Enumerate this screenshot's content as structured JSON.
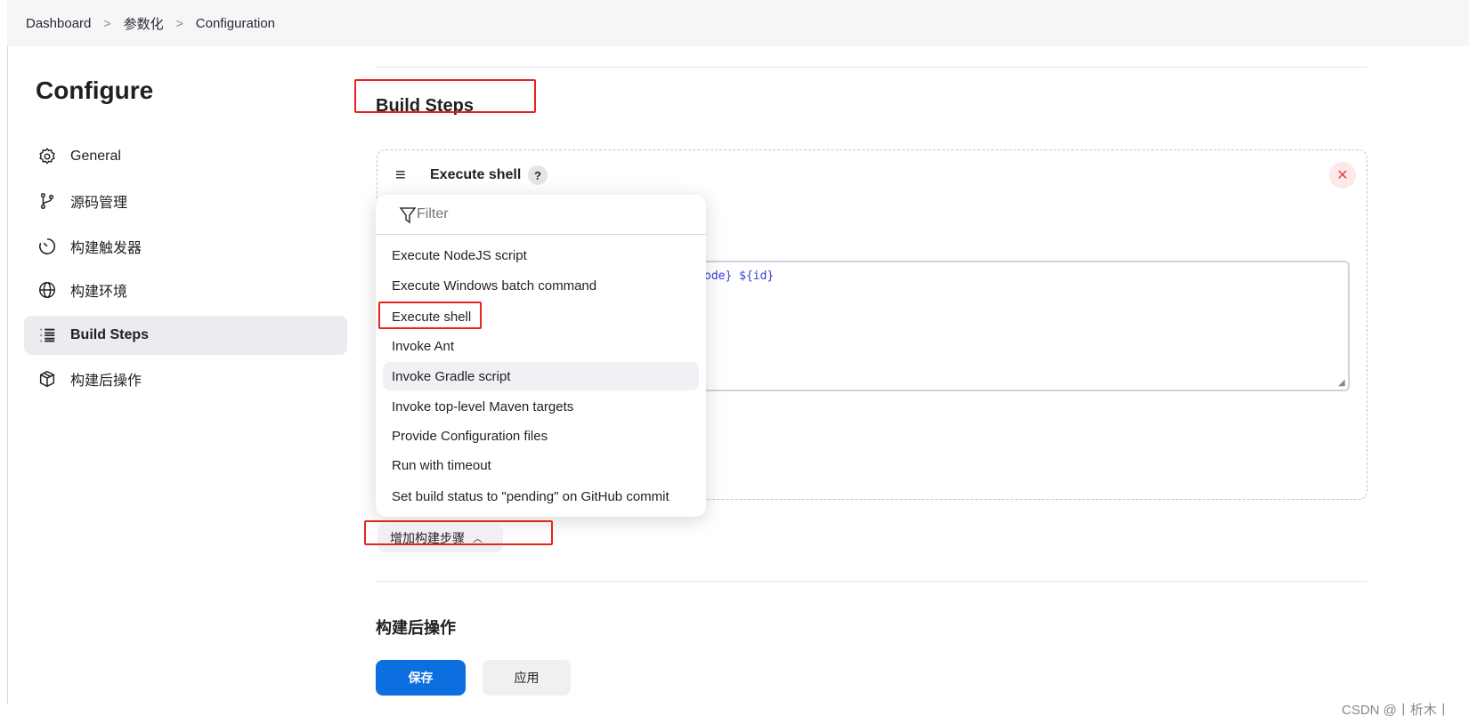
{
  "breadcrumb": [
    "Dashboard",
    "参数化",
    "Configuration"
  ],
  "page_title": "Configure",
  "sidebar": {
    "items": [
      {
        "label": "General",
        "icon": "gear-icon"
      },
      {
        "label": "源码管理",
        "icon": "branch-icon"
      },
      {
        "label": "构建触发器",
        "icon": "timer-icon"
      },
      {
        "label": "构建环境",
        "icon": "globe-icon"
      },
      {
        "label": "Build Steps",
        "icon": "list-icon",
        "active": true
      },
      {
        "label": "构建后操作",
        "icon": "package-icon"
      }
    ]
  },
  "build_steps": {
    "title": "Build Steps",
    "step": {
      "title": "Execute shell",
      "help": "?",
      "command_visible": "ode} ${id}"
    },
    "add_button": "增加构建步骤"
  },
  "dropdown": {
    "filter_placeholder": "Filter",
    "options": [
      "Execute NodeJS script",
      "Execute Windows batch command",
      "Execute shell",
      "Invoke Ant",
      "Invoke Gradle script",
      "Invoke top-level Maven targets",
      "Provide Configuration files",
      "Run with timeout",
      "Set build status to \"pending\" on GitHub commit"
    ],
    "hovered": "Invoke Gradle script",
    "highlighted": "Execute shell"
  },
  "post_build": {
    "title": "构建后操作"
  },
  "footer": {
    "save": "保存",
    "apply": "应用"
  },
  "watermark": "CSDN @丨析木丨",
  "colors": {
    "primary": "#0b6fe0",
    "annotation": "#e8231e",
    "close": "#e5484d"
  }
}
